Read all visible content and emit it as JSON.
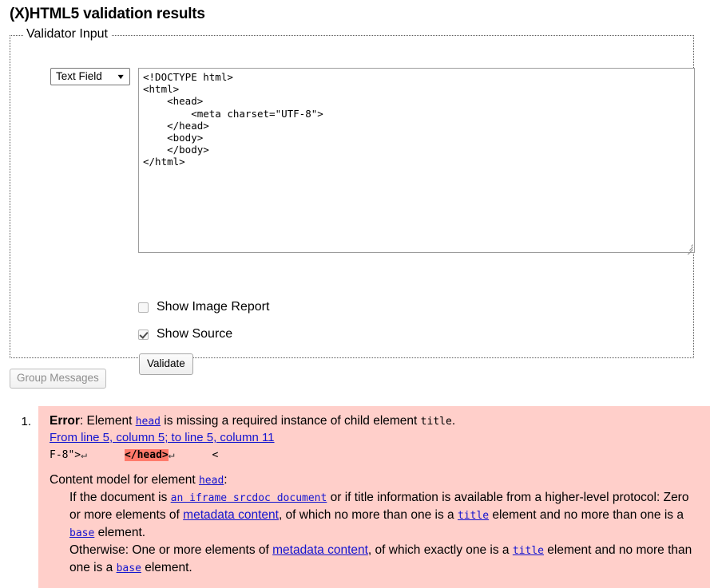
{
  "page": {
    "title": "(X)HTML5 validation results"
  },
  "validator_form": {
    "legend": "Validator Input",
    "source_select": {
      "selected": "Text Field",
      "caret_icon": "chevron-down-icon",
      "options": [
        "Text Field"
      ]
    },
    "code_value": "<!DOCTYPE html>\n<html>\n    <head>\n        <meta charset=\"UTF-8\">\n    </head>\n    <body>\n    </body>\n</html>",
    "options": [
      {
        "label": "Show Image Report",
        "checked": false
      },
      {
        "label": "Show Source",
        "checked": true
      }
    ],
    "validate_label": "Validate"
  },
  "toolbar": {
    "group_messages_label": "Group Messages",
    "group_messages_disabled": true
  },
  "results": {
    "items": [
      {
        "marker": "1.",
        "severity_label": "Error",
        "message_before": ": Element ",
        "message_element": "head",
        "message_middle": " is missing a required instance of child element ",
        "message_element2": "title",
        "message_after": ".",
        "location": "From line 5, column 5; to line 5, column 11",
        "excerpt": {
          "before": "F-8\">",
          "cr1": "↵",
          "gap1": "      ",
          "highlight": "</head>",
          "cr2": "↵",
          "gap2": "      ",
          "after": "<"
        },
        "content_model": {
          "heading_before": "Content model for element ",
          "heading_element": "head",
          "heading_after": ":",
          "paragraph1": {
            "p_a": "If the document is ",
            "link1": "an iframe srcdoc document",
            "link1_mono_part": "iframe srcdoc",
            "p_b": " or if title information is available from a higher-level protocol: Zero or more elements of ",
            "link2": "metadata content",
            "p_c": ", of which no more than one is a ",
            "el_title": "title",
            "p_d": " element and no more than one is a ",
            "el_base": "base",
            "p_e": " element."
          },
          "paragraph2": {
            "p_a": "Otherwise: One or more elements of ",
            "link2": "metadata content",
            "p_b": ", of which exactly one is a ",
            "el_title": "title",
            "p_c": " element and no more than one is a ",
            "el_base": "base",
            "p_d": " element."
          }
        }
      }
    ]
  },
  "colors": {
    "error_background": "#ffcfca",
    "highlight": "#ff7a6b",
    "link": "#1414cf"
  }
}
